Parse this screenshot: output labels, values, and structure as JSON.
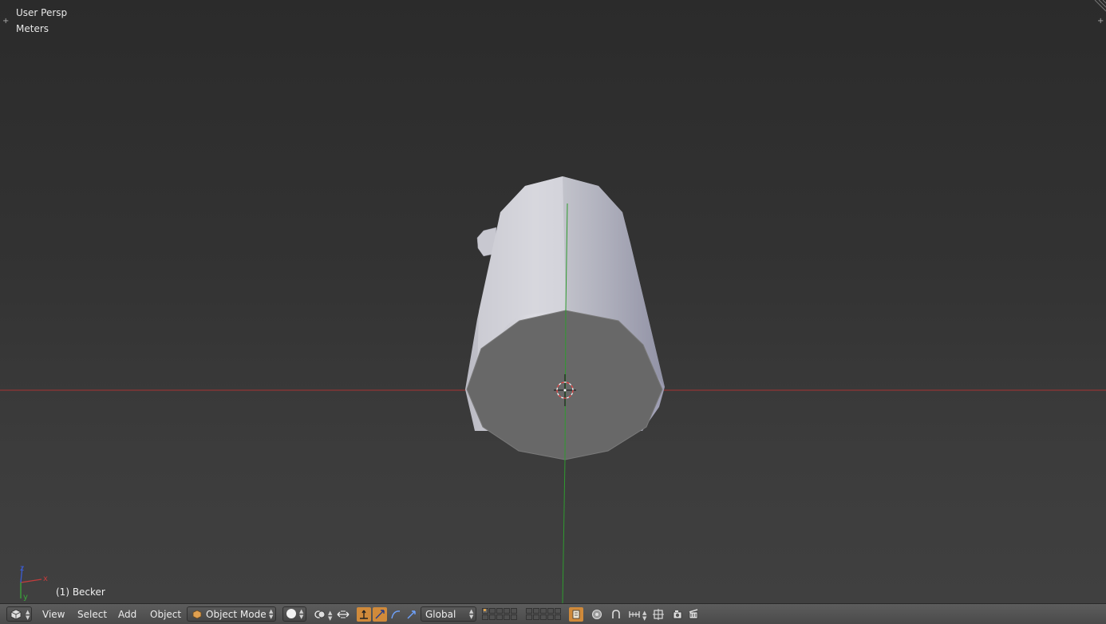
{
  "viewport": {
    "perspective_label": "User Persp",
    "units_label": "Meters",
    "active_object_label": "(1) Becker",
    "axis_colors": {
      "x": "#c43c3c",
      "y": "#3aa83a",
      "z": "#3c5cd0"
    },
    "axis_labels": {
      "x": "x",
      "y": "y",
      "z": "z"
    }
  },
  "header": {
    "editor_type_icon": "cube-icon",
    "menus": {
      "view": "View",
      "select": "Select",
      "add": "Add",
      "object": "Object"
    },
    "mode_selector": {
      "value": "Object Mode",
      "icon": "object-mode-icon"
    },
    "shading_icon": "solid-sphere-icon",
    "pivot_icon": "pivot-point-icon",
    "manipulator_icon": "manipulator-toggle-icon",
    "transform_orientation": "Global",
    "accent_color": "#d08a3a"
  }
}
